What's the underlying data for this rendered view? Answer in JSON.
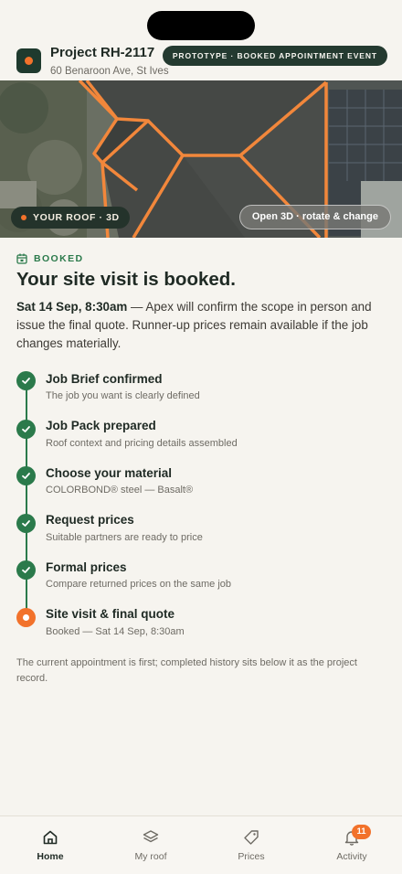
{
  "header": {
    "project_title": "Project RH-2117",
    "address": "60 Benaroon Ave, St Ives",
    "prototype_badge": "PROTOTYPE · BOOKED APPOINTMENT EVENT"
  },
  "roof_preview": {
    "chip_label": "YOUR ROOF · 3D",
    "open_3d_label": "Open 3D · rotate & change",
    "outline_color": "#f2873b"
  },
  "status": {
    "label": "BOOKED",
    "headline": "Your site visit is booked.",
    "date_time": "Sat 14 Sep, 8:30am",
    "description": " — Apex will confirm the scope in person and issue the final quote. Runner-up prices remain available if the job changes materially."
  },
  "steps": [
    {
      "title": "Job Brief confirmed",
      "subtitle": "The job you want is clearly defined",
      "state": "done"
    },
    {
      "title": "Job Pack prepared",
      "subtitle": "Roof context and pricing details assembled",
      "state": "done"
    },
    {
      "title": "Choose your material",
      "subtitle": "COLORBOND® steel — Basalt®",
      "state": "done"
    },
    {
      "title": "Request prices",
      "subtitle": "Suitable partners are ready to price",
      "state": "done"
    },
    {
      "title": "Formal prices",
      "subtitle": "Compare returned prices on the same job",
      "state": "done"
    },
    {
      "title": "Site visit & final quote",
      "subtitle": "Booked — Sat 14 Sep, 8:30am",
      "state": "current"
    }
  ],
  "footnote": "The current appointment is first; completed history sits below it as the project record.",
  "bottom_nav": {
    "items": [
      {
        "label": "Home",
        "icon": "home-icon",
        "active": true
      },
      {
        "label": "My roof",
        "icon": "layers-icon"
      },
      {
        "label": "Prices",
        "icon": "tag-icon"
      },
      {
        "label": "Activity",
        "icon": "bell-icon",
        "badge": "11"
      }
    ]
  },
  "colors": {
    "brand_green": "#2b7a4b",
    "accent_orange": "#f2722b",
    "dark_green": "#243a30",
    "background": "#f6f4ef"
  }
}
